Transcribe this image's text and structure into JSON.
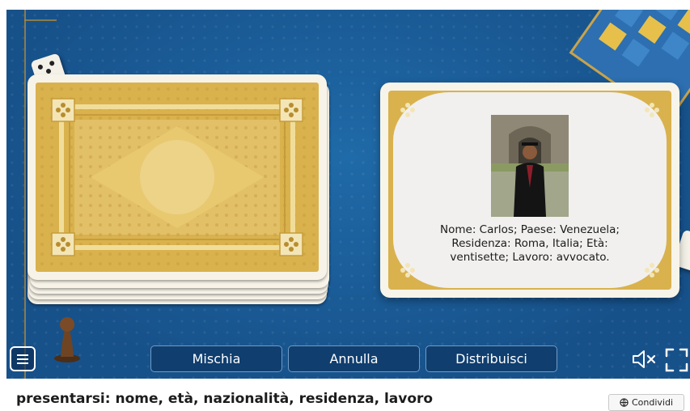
{
  "card": {
    "description_lines": [
      "Nome: Carlos; Paese: Venezuela;",
      "Residenza: Roma, Italia; Età:",
      "ventisette; Lavoro: avvocato."
    ]
  },
  "toolbar": {
    "shuffle_label": "Mischia",
    "undo_label": "Annulla",
    "deal_label": "Distribuisci"
  },
  "footer": {
    "title": "presentarsi: nome, età, nazionalità, residenza, lavoro",
    "share_label": "Condividi"
  },
  "icons": {
    "menu": "hamburger-menu-icon",
    "mute": "speaker-muted-icon",
    "fullscreen": "fullscreen-icon",
    "share": "globe-icon"
  },
  "colors": {
    "table_blue": "#1a5a96",
    "card_gold": "#d9b24e",
    "button_blue": "#0f3e6f"
  }
}
